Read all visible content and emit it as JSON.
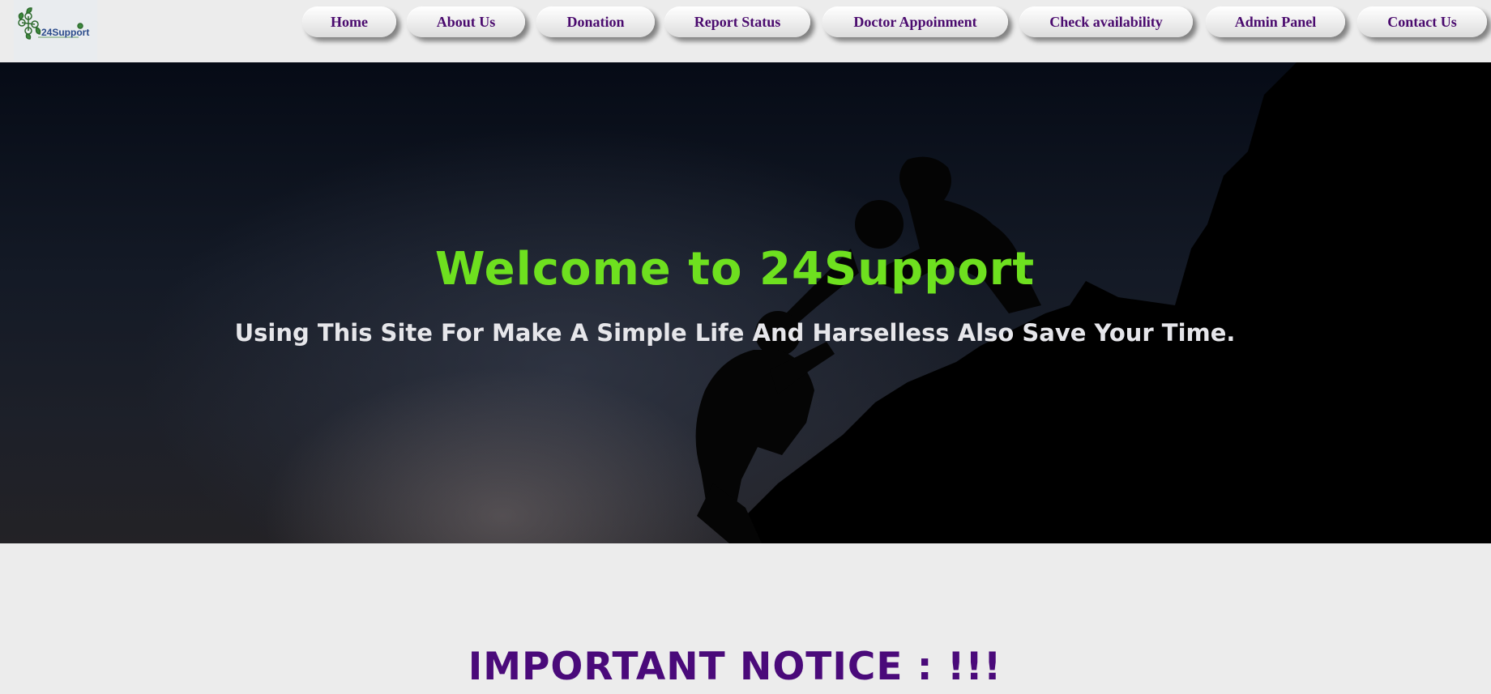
{
  "brand": {
    "logo_text": "24Support",
    "logo_icon": "leaf-network-icon"
  },
  "nav": {
    "items": [
      {
        "label": "Home"
      },
      {
        "label": "About Us"
      },
      {
        "label": "Donation"
      },
      {
        "label": "Report Status"
      },
      {
        "label": "Doctor Appoinment"
      },
      {
        "label": "Check availability"
      },
      {
        "label": "Admin Panel"
      },
      {
        "label": "Contact Us"
      }
    ]
  },
  "hero": {
    "title": "Welcome to 24Support",
    "subtitle": "Using This Site For Make A Simple Life And Harselless Also Save Your Time."
  },
  "notice": {
    "heading": "IMPORTANT NOTICE : !!!"
  },
  "colors": {
    "nav_text": "#4a0a6e",
    "hero_title": "#6ee01f",
    "hero_subtitle": "#e6e6ea",
    "notice": "#4a0a7a",
    "page_bg": "#ececec"
  }
}
